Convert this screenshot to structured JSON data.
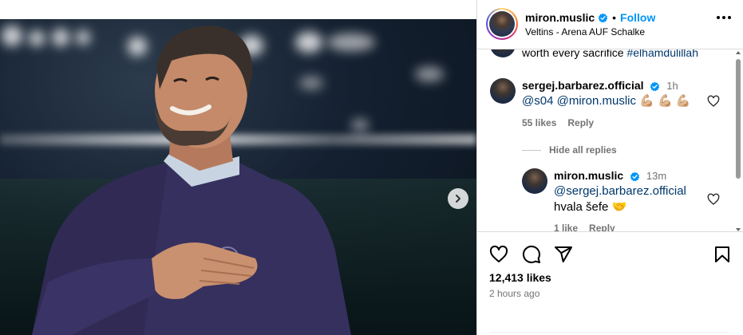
{
  "post": {
    "author": "miron.muslic",
    "follow_label": "Follow",
    "separator": "•",
    "location": "Veltins - Arena AUF Schalke"
  },
  "comments": {
    "partial_top": {
      "text_pre": "worth every sacrifice ",
      "hashtag": "#elhamdulillah"
    },
    "items": [
      {
        "username": "sergej.barbarez.official",
        "time": "1h",
        "mention1": "@s04",
        "mention2": "@miron.muslic",
        "emoji": "💪🏼 💪🏼 💪🏼",
        "likes": "55 likes",
        "reply_label": "Reply"
      }
    ],
    "hide_replies_label": "Hide all replies",
    "reply": {
      "username": "miron.muslic",
      "time": "13m",
      "mention": "@sergej.barbarez.official",
      "text": "hvala šefe",
      "emoji": "🤝",
      "likes": "1 like",
      "reply_label": "Reply"
    }
  },
  "actions": {
    "likes_count": "12,413 likes",
    "time_ago": "2 hours ago",
    "icons": [
      "heart-icon",
      "comment-icon",
      "share-icon",
      "bookmark-icon"
    ]
  },
  "carousel": {
    "slide_count": 3,
    "active_slide": 1
  },
  "colors": {
    "link_blue": "#0095f6",
    "mention_blue": "#00376b",
    "verified_blue": "#0095f6",
    "muted_gray": "#737373"
  }
}
